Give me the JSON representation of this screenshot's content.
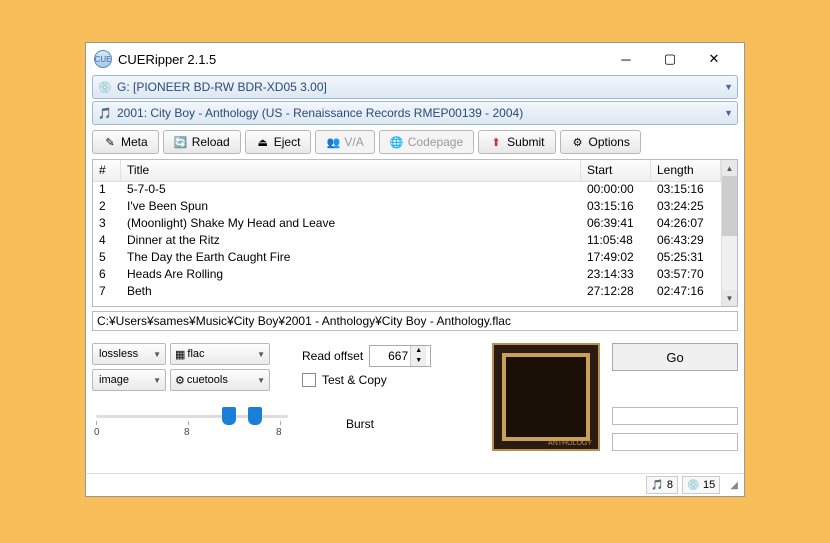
{
  "window": {
    "title": "CUERipper 2.1.5"
  },
  "drive_combo": "G: [PIONEER  BD-RW   BDR-XD05 3.00]",
  "album_combo": "2001: City Boy - Anthology (US - Renaissance Records RMEP00139 - 2004)",
  "toolbar": {
    "meta": "Meta",
    "reload": "Reload",
    "eject": "Eject",
    "va": "V/A",
    "codepage": "Codepage",
    "submit": "Submit",
    "options": "Options"
  },
  "columns": {
    "num": "#",
    "title": "Title",
    "start": "Start",
    "length": "Length"
  },
  "tracks": [
    {
      "n": "1",
      "title": "5-7-0-5",
      "start": "00:00:00",
      "length": "03:15:16"
    },
    {
      "n": "2",
      "title": "I've Been Spun",
      "start": "03:15:16",
      "length": "03:24:25"
    },
    {
      "n": "3",
      "title": "(Moonlight) Shake My Head and Leave",
      "start": "06:39:41",
      "length": "04:26:07"
    },
    {
      "n": "4",
      "title": "Dinner at the Ritz",
      "start": "11:05:48",
      "length": "06:43:29"
    },
    {
      "n": "5",
      "title": "The Day the Earth Caught Fire",
      "start": "17:49:02",
      "length": "05:25:31"
    },
    {
      "n": "6",
      "title": "Heads Are Rolling",
      "start": "23:14:33",
      "length": "03:57:70"
    },
    {
      "n": "7",
      "title": "Beth",
      "start": "27:12:28",
      "length": "02:47:16"
    }
  ],
  "output_path": "C:¥Users¥sames¥Music¥City Boy¥2001 - Anthology¥City Boy - Anthology.flac",
  "encoding": {
    "mode": "lossless",
    "codec": "flac",
    "image_mode": "image",
    "writer": "cuetools"
  },
  "read_offset_label": "Read offset",
  "read_offset_value": "667",
  "test_copy_label": "Test & Copy",
  "slider": {
    "min": "0",
    "mid": "8",
    "max": "8",
    "mode_label": "Burst"
  },
  "go_label": "Go",
  "status": {
    "db1": "8",
    "db2": "15"
  }
}
